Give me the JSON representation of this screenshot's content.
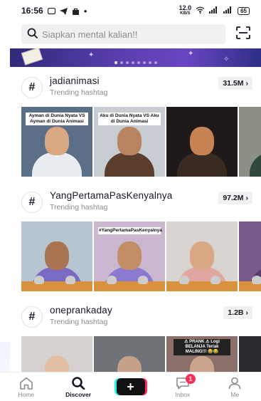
{
  "status_bar": {
    "time": "16:56",
    "speed": "12.0",
    "speed_unit": "KB/S",
    "battery": "65"
  },
  "search": {
    "placeholder": "Siapkan mental kalian!!"
  },
  "sections": [
    {
      "tag": "jadianimasi",
      "subtitle": "Trending hashtag",
      "count": "31.5M",
      "thumbs": [
        {
          "overlay": "Ayman di Dunia Nyata VS Ayman di Dunia Animasi",
          "bg": "#5b6f86",
          "skin": "#d9a780",
          "shirt": "#e9edf2"
        },
        {
          "overlay": "Aku di Dunia Nyata VS Aku di Dunia Animasi",
          "bg": "#c7cdd3",
          "skin": "#b98462",
          "shirt": "#5b3d2b"
        },
        {
          "overlay": "",
          "bg": "#1e1a1a",
          "skin": "#c78354",
          "shirt": "#3a2b22"
        },
        {
          "overlay": "",
          "bg": "#8c8f86",
          "skin": "#c9a07a",
          "shirt": "#2f4a3a"
        }
      ]
    },
    {
      "tag": "YangPertamaPasKenyalnya",
      "subtitle": "Trending hashtag",
      "count": "97.2M",
      "thumbs": [
        {
          "overlay": "",
          "bg": "#b7c4d2",
          "skin": "#a9744f",
          "shirt": "#7b6ac4"
        },
        {
          "overlay": "#YangPertamaPasKenyalnya",
          "bg": "#c9b8cf",
          "skin": "#c38d66",
          "shirt": "#8b78cf"
        },
        {
          "overlay": "",
          "bg": "#d9d4d0",
          "skin": "#d7a883",
          "shirt": "#e0a7a2"
        },
        {
          "overlay": "",
          "bg": "#7a5a8c",
          "skin": "#c69574",
          "shirt": "#5a3b6b"
        }
      ]
    },
    {
      "tag": "oneprankaday",
      "subtitle": "Trending hashtag",
      "count": "1.2B",
      "thumbs": [
        {
          "overlay": "",
          "bg": "#d7d2cf",
          "skin": "#e4bea0",
          "shirt": "#ffffff"
        },
        {
          "overlay": "",
          "bg": "#6f7378",
          "skin": "#c6a08a",
          "shirt": "#3a3d44"
        },
        {
          "overlay": "⚠ PRANK ⚠ Logi BELANJA Teriak MALING!!! 😂😂",
          "bg": "#8a6f6a",
          "skin": "#caa48c",
          "shirt": "#b23a3a"
        },
        {
          "overlay": "",
          "bg": "#2a2a2e",
          "skin": "#b68a6c",
          "shirt": "#444"
        }
      ]
    }
  ],
  "nav": {
    "home": "Home",
    "discover": "Discover",
    "inbox": "Inbox",
    "inbox_badge": "1",
    "me": "Me"
  },
  "colors": {
    "accent_red": "#fe2c55",
    "accent_cyan": "#25f4ee"
  }
}
